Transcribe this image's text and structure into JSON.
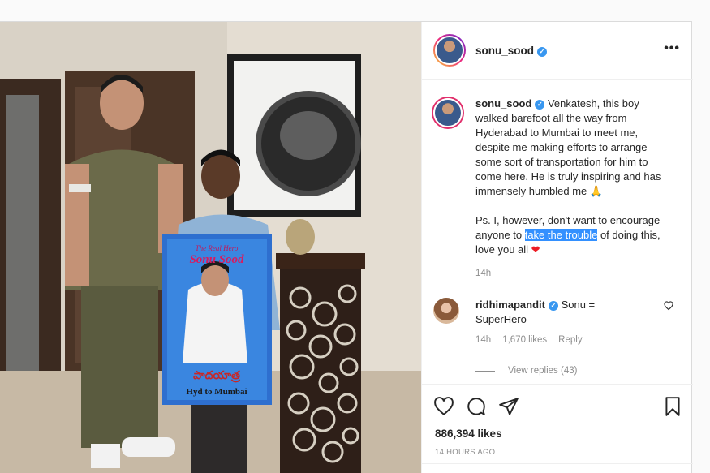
{
  "post": {
    "username": "sonu_sood",
    "verified_mark": "✓",
    "more_label": "•••",
    "photo": {
      "board_line1": "The Real Hero",
      "board_line2": "Sonu Sood",
      "board_telugu": "పాదయాత్ర",
      "board_line3": "Hyd to Mumbai"
    },
    "caption": {
      "username": "sonu_sood",
      "text_part1": "Venkatesh, this boy walked barefoot all the way from Hyderabad to Mumbai to meet me, despite me making efforts to arrange some sort of transportation for him to come here. He is truly inspiring and has immensely humbled me 🙏",
      "text_part2": "Ps. I, however, don't want to encourage anyone to ",
      "highlight": "take the trouble",
      "text_part3": " of doing this, love you all ",
      "heart": "❤",
      "time": "14h"
    },
    "comment": {
      "username": "ridhimapandit",
      "text": "Sonu = SuperHero",
      "time": "14h",
      "likes": "1,670 likes",
      "reply": "Reply",
      "view_replies": "View replies (43)"
    },
    "likes": "886,394 likes",
    "posted_ago": "14 HOURS AGO",
    "icons": [
      "heart-icon",
      "comment-icon",
      "share-icon",
      "bookmark-icon"
    ],
    "colors": {
      "verified": "#3897f0",
      "highlight": "#3390ff",
      "heart": "#ed1c24"
    }
  }
}
